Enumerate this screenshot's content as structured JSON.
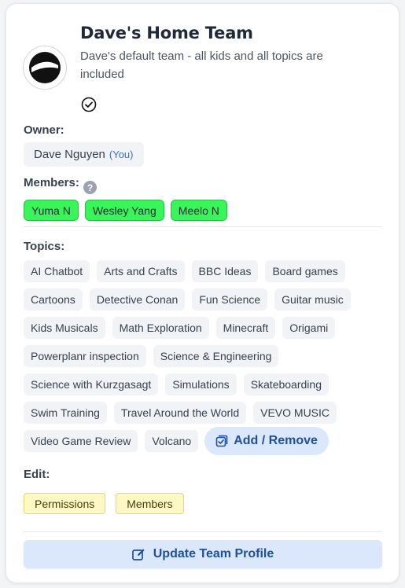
{
  "team": {
    "name": "Dave's Home Team",
    "description": "Dave's default team - all kids and all topics are included"
  },
  "owner": {
    "label": "Owner:",
    "name": "Dave Nguyen",
    "you_tag": "(You)"
  },
  "members": {
    "label": "Members:",
    "help": "?",
    "items": [
      "Yuma N",
      "Wesley Yang",
      "Meelo N"
    ]
  },
  "topics": {
    "label": "Topics:",
    "rows": [
      [
        "AI Chatbot",
        "Arts and Crafts",
        "BBC Ideas",
        "Board games"
      ],
      [
        "Cartoons",
        "Detective Conan",
        "Fun Science",
        "Guitar music"
      ],
      [
        "Kids Musicals",
        "Math Exploration",
        "Minecraft",
        "Origami"
      ],
      [
        "Powerplanr inspection",
        "Science & Engineering"
      ],
      [
        "Science with Kurzgasagt",
        "Simulations",
        "Skateboarding"
      ],
      [
        "Swim Training",
        "Travel Around the World",
        "VEVO MUSIC"
      ],
      [
        "Video Game Review",
        "Volcano"
      ]
    ],
    "add_remove_label": "Add / Remove"
  },
  "edit": {
    "label": "Edit:",
    "permissions_label": "Permissions",
    "members_label": "Members"
  },
  "update_button_label": "Update Team Profile",
  "colors": {
    "member_chip": "#39f55a",
    "edit_chip": "#fef9c3",
    "primary_button_bg": "#dbe8fb",
    "primary_button_text": "#1e4fa0"
  }
}
